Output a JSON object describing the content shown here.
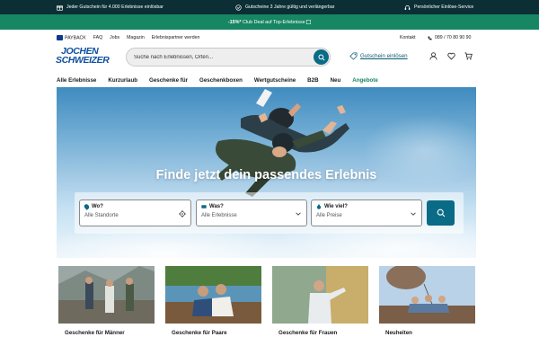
{
  "usp": [
    {
      "icon": "gift-icon",
      "text": "Jeder Gutschein für 4.000 Erlebnisse einlösbar"
    },
    {
      "icon": "check-circle-icon",
      "text": "Gutscheine 3 Jahre gültig und verlängerbar"
    },
    {
      "icon": "headset-icon",
      "text": "Persönlicher Einlöse-Service"
    }
  ],
  "promo": {
    "highlight": "-15%*",
    "text": "Club Deal auf Top-Erlebnisse",
    "icon": "info-icon"
  },
  "meta_nav": {
    "payback": "PAYBACK",
    "items": [
      "FAQ",
      "Jobs",
      "Magazin",
      "Erlebnispartner werden"
    ],
    "contact": "Kontakt",
    "phone": "089 / 70 80 90 90"
  },
  "logo": {
    "line1": "JOCHEN",
    "line2": "SCHWEIZER"
  },
  "search": {
    "placeholder": "Suche nach Erlebnissen, Orten..."
  },
  "voucher": {
    "label": "Gutschein einlösen"
  },
  "header_icons": [
    "user-icon",
    "heart-icon",
    "cart-icon"
  ],
  "main_nav": [
    {
      "label": "Alle Erlebnisse"
    },
    {
      "label": "Kurzurlaub"
    },
    {
      "label": "Geschenke für"
    },
    {
      "label": "Geschenkboxen"
    },
    {
      "label": "Wertgutscheine"
    },
    {
      "label": "B2B"
    },
    {
      "label": "Neu"
    },
    {
      "label": "Angebote"
    }
  ],
  "hero": {
    "title": "Finde jetzt dein passendes Erlebnis"
  },
  "finder": {
    "where": {
      "label": "Wo?",
      "value": "Alle Standorte"
    },
    "what": {
      "label": "Was?",
      "value": "Alle Erlebnisse"
    },
    "price": {
      "label": "Wie viel?",
      "value": "Alle Preise"
    }
  },
  "cards": [
    {
      "label": "Geschenke für Männer"
    },
    {
      "label": "Geschenke für Paare"
    },
    {
      "label": "Geschenke für Frauen"
    },
    {
      "label": "Neuheiten"
    }
  ],
  "colors": {
    "dark": "#0c2f35",
    "green": "#178663",
    "petrol": "#0a6b86",
    "brand_blue": "#0e4f9f"
  }
}
